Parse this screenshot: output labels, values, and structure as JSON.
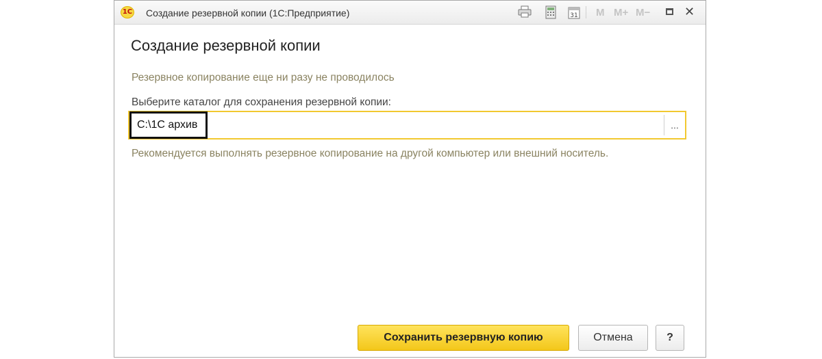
{
  "window": {
    "title": "Создание резервной копии  (1С:Предприятие)",
    "logo_text": "1С",
    "toolbar": {
      "m_label": "M",
      "m_plus_label": "M+",
      "m_minus_label": "M−",
      "calendar_day": "31"
    }
  },
  "form": {
    "heading": "Создание резервной копии",
    "status": "Резервное копирование еще ни разу не проводилось",
    "catalog_label": "Выберите каталог для сохранения резервной копии:",
    "catalog_value": "C:\\1C архив",
    "browse_label": "...",
    "hint": "Рекомендуется выполнять резервное копирование на другой компьютер или внешний носитель."
  },
  "buttons": {
    "save": "Сохранить резервную копию",
    "cancel": "Отмена",
    "help": "?"
  },
  "colors": {
    "accent": "#f3c71a",
    "hint_text": "#8a8361"
  }
}
